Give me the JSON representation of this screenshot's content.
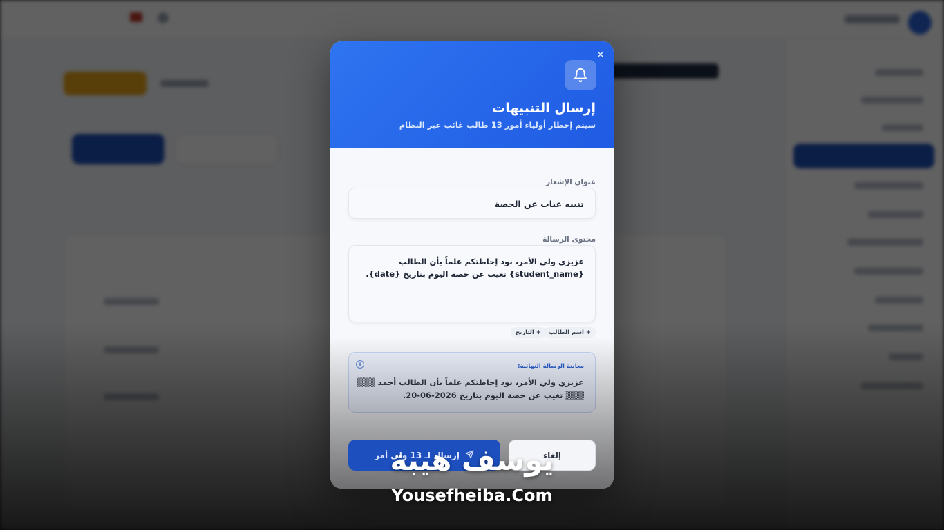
{
  "modal": {
    "title": "إرسال التنبيهات",
    "subtitle": "سيتم إخطار أولياء أمور 13 طالب غائب عبر النظام",
    "title_label": "عنوان الإشعار",
    "title_value": "تنبيه غياب عن الحصة",
    "message_label": "محتوى الرسالة",
    "message_value": "عزيزي ولي الأمر، نود إحاطتكم علماً بأن الطالب {student_name} تغيب عن حصة اليوم بتاريخ {date}.",
    "chips": [
      "+ اسم الطالب",
      "+ التاريخ"
    ],
    "preview_title": "معاينة الرسالة النهائية:",
    "preview_text": "عزيزي ولي الأمر، نود إحاطتكم علماً بأن الطالب أحمد ▒▒▒ ▒▒▒ تغيب عن حصة اليوم بتاريخ 2026-06-20.",
    "send_label": "إرسال لـ 13 ولي أمر",
    "cancel_label": "إلغاء"
  },
  "icons": {
    "close": "close-icon",
    "bell": "bell-icon",
    "info": "info-icon",
    "send": "send-icon"
  },
  "colors": {
    "header_blue": "#2563eb",
    "send_blue": "#1d4fbf",
    "preview_bg": "#eef3ff"
  },
  "watermark": {
    "arabic": "يوسف هيبة",
    "latin": "Yousefheiba.Com"
  }
}
